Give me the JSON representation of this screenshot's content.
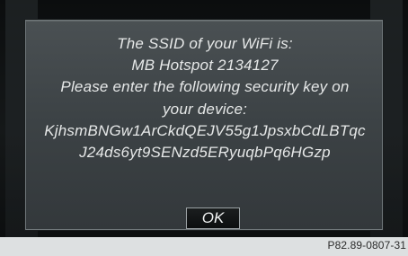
{
  "dialog": {
    "lines": [
      "The SSID of your WiFi is:",
      "MB Hotspot 2134127",
      "Please enter the following security key on",
      "your device:",
      "KjhsmBNGw1ArCkdQEJV55g1JpsxbCdLBTqc",
      "J24ds6yt9SENzd5ERyuqbPq6HGzp"
    ],
    "ok_label": "OK"
  },
  "footer": {
    "reference": "P82.89-0807-31"
  },
  "colors": {
    "screen_background": "#0b0d0e",
    "dialog_background": "#44494c",
    "dialog_border": "#6f7679",
    "text": "#e6e8e8",
    "page_background": "#dde0e1"
  }
}
